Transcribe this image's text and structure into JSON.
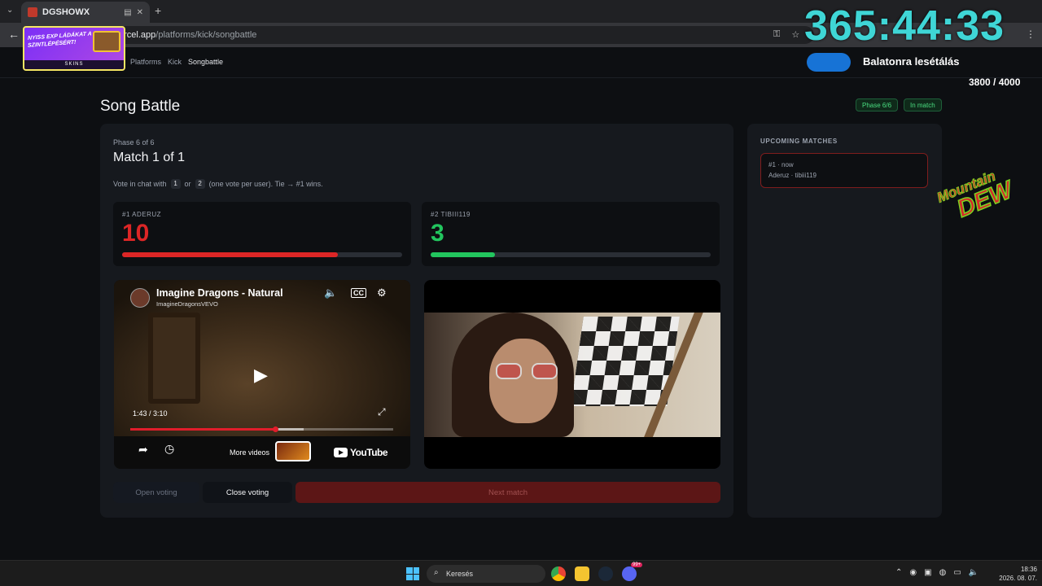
{
  "browser": {
    "tab_title": "DGSHOWX",
    "url_host": "ercel.app",
    "url_path": "/platforms/kick/songbattle"
  },
  "overlay": {
    "ad_text": "NYISS EXP LÁDÁKAT A SZINTLÉPÉSÉRT!",
    "ad_brand": "SKINS",
    "timer": "365:44:33",
    "goal_title": "Balatonra lesétálás",
    "goal_count": "3800 / 4000",
    "goal_progress": 0.95,
    "sponsor_top": "Mountain",
    "sponsor_bottom": "DEW"
  },
  "breadcrumbs": [
    "Platforms",
    "Kick",
    "Songbattle"
  ],
  "page": {
    "title": "Song Battle",
    "badge_phase": "Phase 6/6",
    "badge_status": "In match"
  },
  "match": {
    "phase_text": "Phase 6 of 6",
    "title": "Match 1 of 1",
    "vote_prefix": "Vote in chat with",
    "key1": "1",
    "or": "or",
    "key2": "2",
    "vote_suffix": "(one vote per user). Tie → #1 wins."
  },
  "contestants": [
    {
      "label": "#1 ADERUZ",
      "votes": "10",
      "share": 0.77,
      "color": "#dc2626"
    },
    {
      "label": "#2 TIBIII119",
      "votes": "3",
      "share": 0.23,
      "color": "#22c55e"
    }
  ],
  "youtube": {
    "title": "Imagine Dragons - Natural",
    "channel": "ImagineDragonsVEVO",
    "time": "1:43 / 3:10",
    "progress": 0.55,
    "buffered": 0.66,
    "more_videos": "More videos",
    "logo": "YouTube"
  },
  "buttons": {
    "open": "Open voting",
    "close": "Close voting",
    "next": "Next match"
  },
  "sidebar": {
    "title": "UPCOMING MATCHES",
    "item_line1": "#1 · now",
    "item_line2": "Aderuz · tibiii119"
  },
  "taskbar": {
    "search": "Keresés",
    "time": "18:36",
    "date": "2026. 08. 07.",
    "discord_badge": "99+"
  },
  "colors": {
    "accent_red": "#dc2626",
    "accent_green": "#22c55e",
    "timer_cyan": "#3fd6d6"
  }
}
